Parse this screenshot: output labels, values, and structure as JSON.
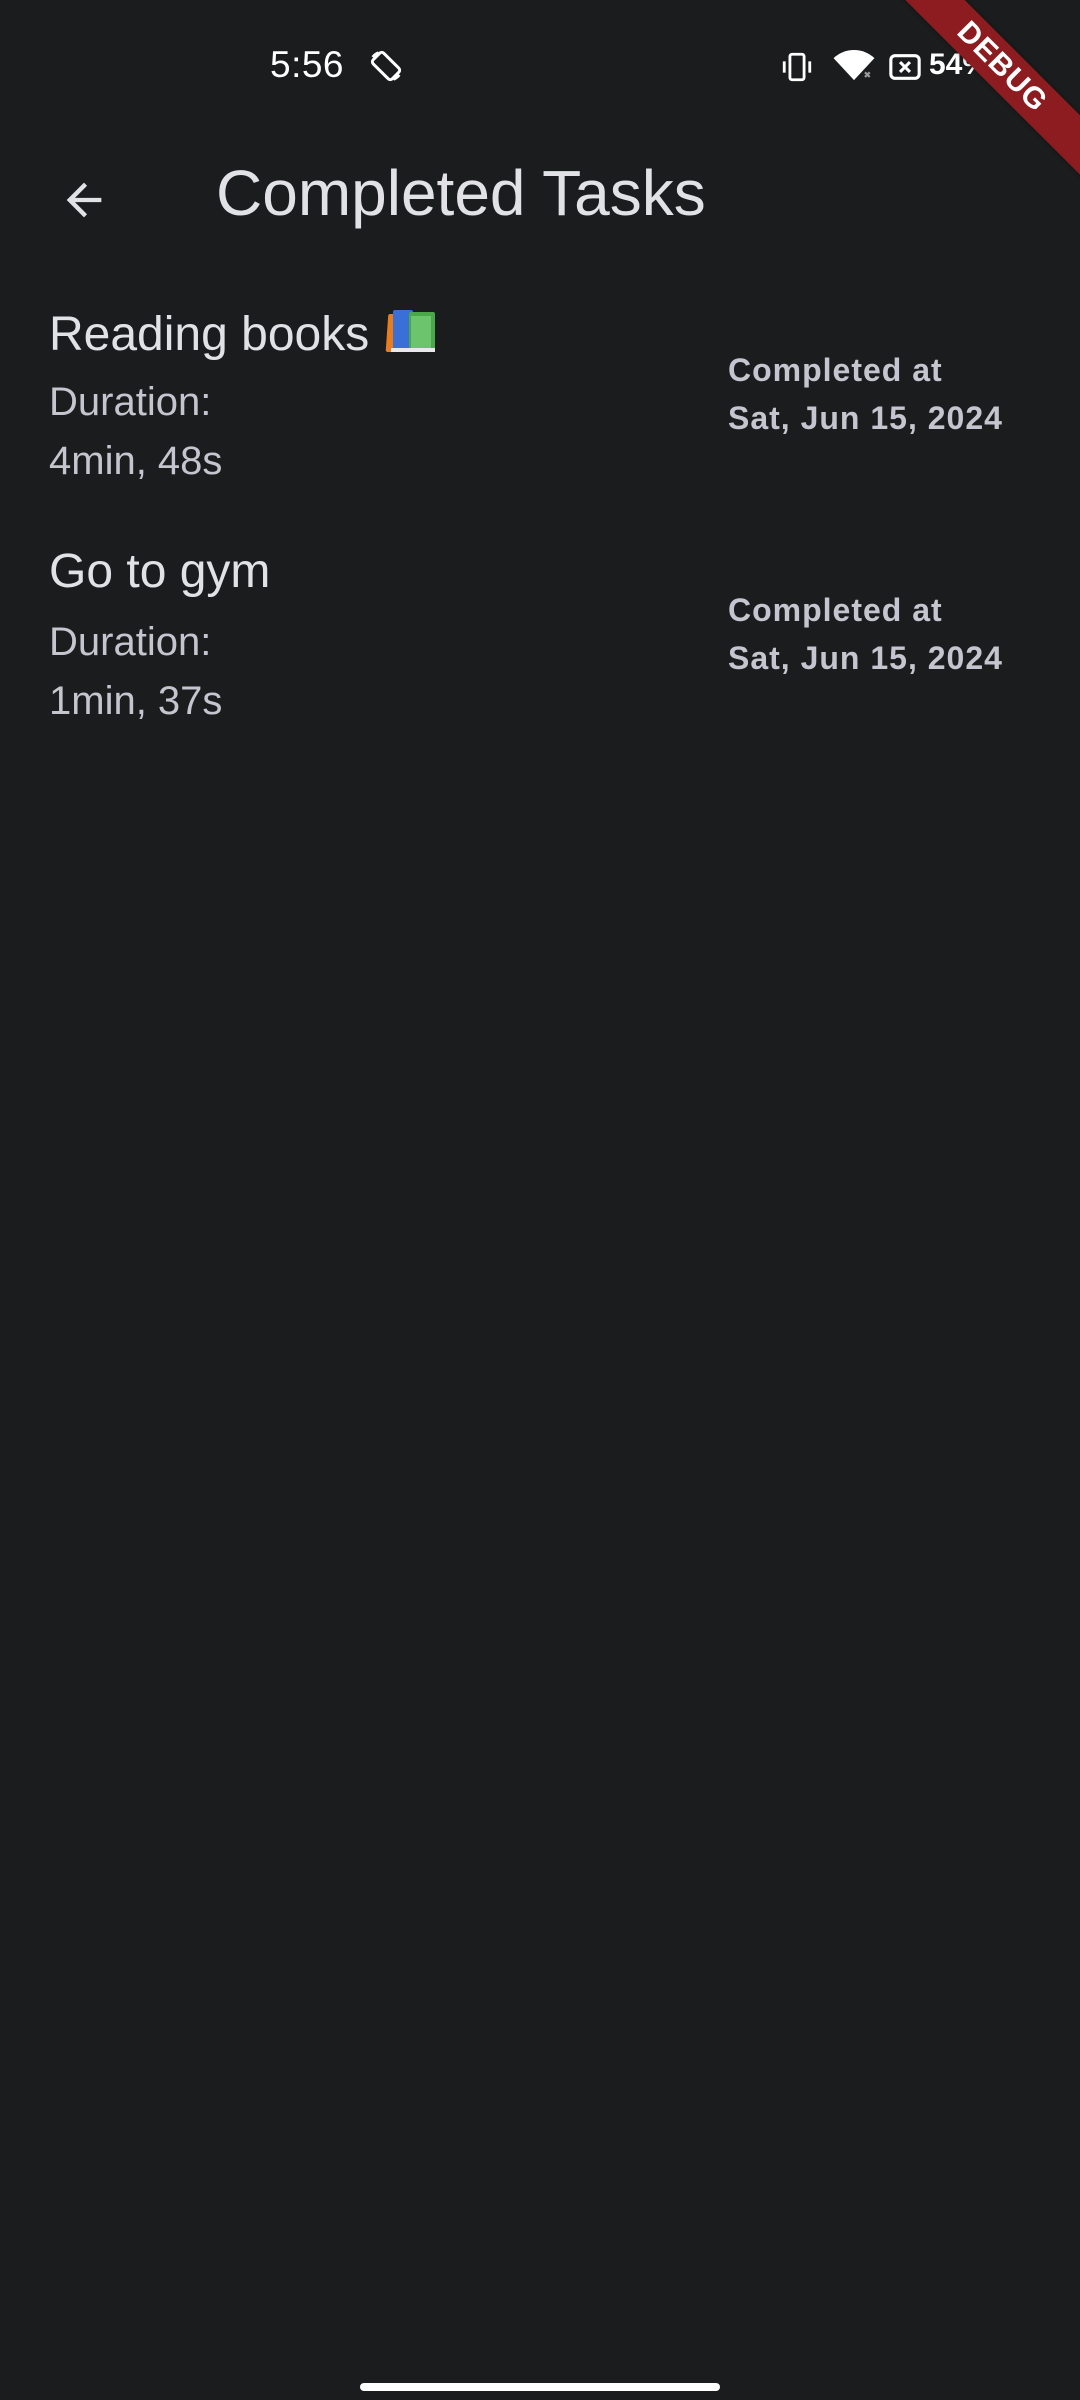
{
  "status_bar": {
    "time": "5:56",
    "battery_percent": "54%",
    "icons": [
      "rotate-icon",
      "vibrate-icon",
      "wifi-icon",
      "battery-saver-icon"
    ]
  },
  "debug_banner": "DEBUG",
  "app_bar": {
    "title": "Completed Tasks",
    "back_icon": "arrow-back-icon"
  },
  "tasks": [
    {
      "name": "Reading books",
      "emoji": "books-icon",
      "duration_label": "Duration:",
      "duration": "4min, 48s",
      "completed_label": "Completed at",
      "completed_date": "Sat, Jun 15, 2024"
    },
    {
      "name": "Go to gym",
      "duration_label": "Duration:",
      "duration": "1min, 37s",
      "completed_label": "Completed at",
      "completed_date": "Sat, Jun 15, 2024"
    }
  ],
  "colors": {
    "background": "#1a1c1e",
    "primary_text": "#e2e2e6",
    "secondary_text": "#c4c6cf",
    "debug_ribbon": "#8c1c20"
  }
}
